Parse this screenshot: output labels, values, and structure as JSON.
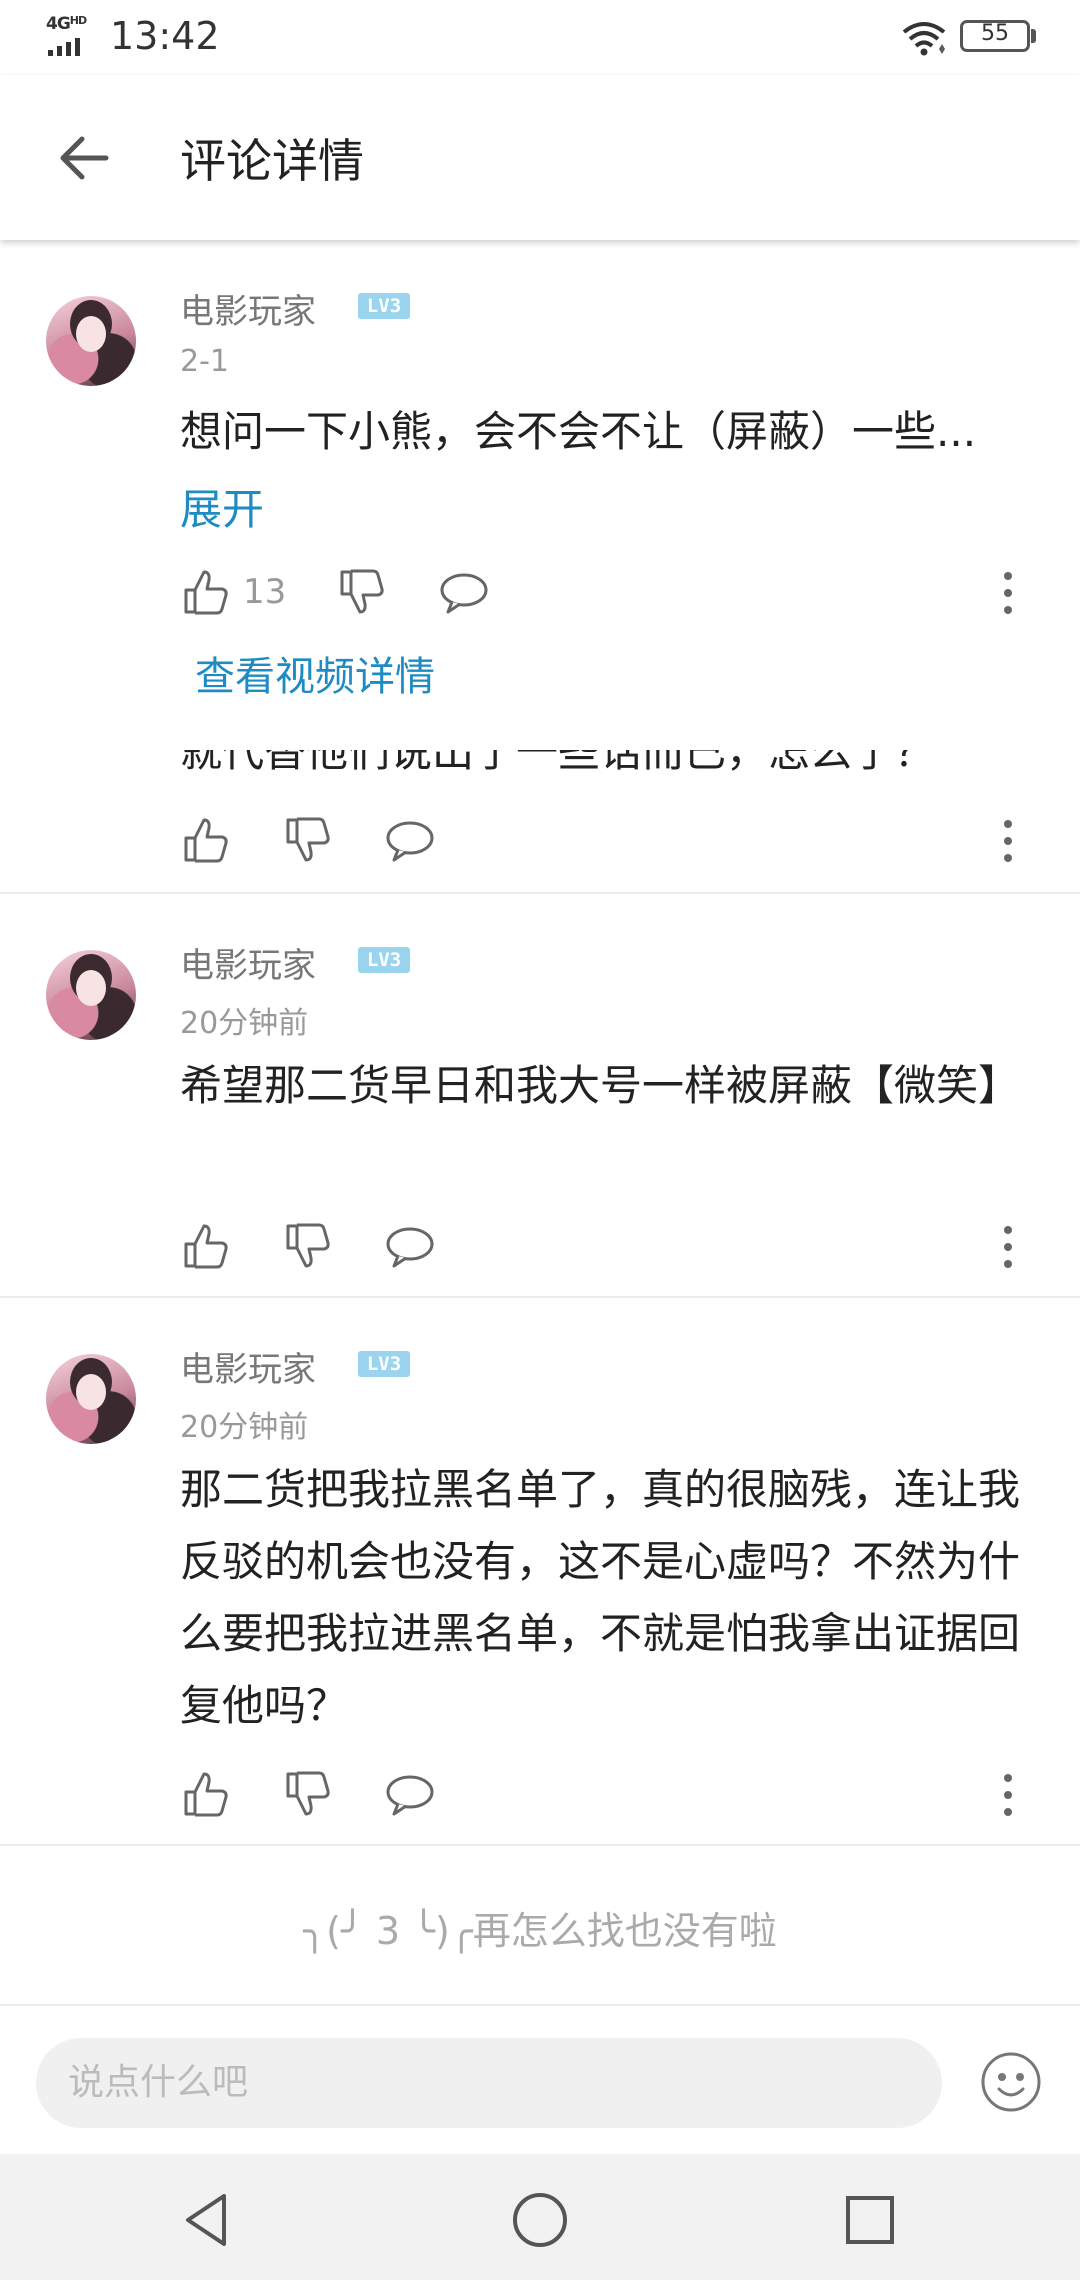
{
  "status_bar": {
    "network": "4G",
    "network_sup": "HD",
    "time": "13:42",
    "battery": "55",
    "battery_level": 0.55
  },
  "header": {
    "title": "评论详情"
  },
  "main_comment": {
    "username": "电影玩家",
    "level": "LV3",
    "time": "2-1",
    "content": "想问一下小熊，会不会不让（屏蔽）一些...",
    "expand_label": "展开",
    "like_count": "13",
    "video_link": "查看视频详情"
  },
  "clipped_reply_text": "就代替他们说出了一些话而已，怎么了？",
  "replies": [
    {
      "username": "电影玩家",
      "level": "LV3",
      "time": "20分钟前",
      "content": "希望那二货早日和我大号一样被屏蔽【微笑】"
    },
    {
      "username": "电影玩家",
      "level": "LV3",
      "time": "20分钟前",
      "content": "那二货把我拉黑名单了，真的很脑残，连让我反驳的机会也没有，这不是心虚吗？不然为什么要把我拉进黑名单，不就是怕我拿出证据回复他吗？"
    }
  ],
  "end_message": "╮(╯ 3 ╰)╭再怎么找也没有啦",
  "input": {
    "placeholder": "说点什么吧"
  },
  "colors": {
    "link": "#1e8bc3",
    "level_badge": "#9ad4ee",
    "muted": "#999999"
  },
  "icons": [
    "back-arrow-icon",
    "thumbs-up-icon",
    "thumbs-down-icon",
    "comment-bubble-icon",
    "more-vertical-icon",
    "emoji-icon",
    "nav-back-icon",
    "nav-home-icon",
    "nav-recents-icon"
  ]
}
